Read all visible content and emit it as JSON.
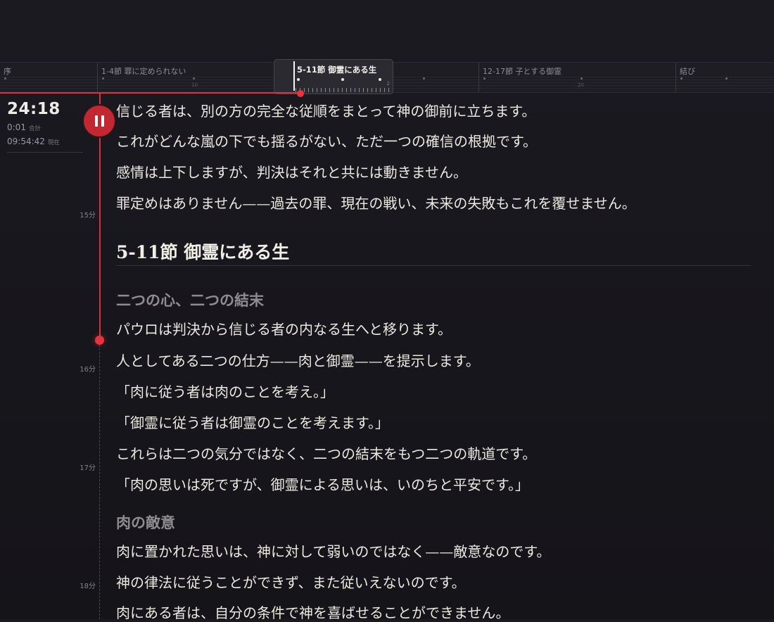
{
  "timeline": {
    "segments": [
      {
        "label": "序"
      },
      {
        "label": "1-4節 罪に定められない"
      },
      {
        "label": "5-11節 御霊にある生"
      },
      {
        "label": "12-17節 子とする御霊"
      },
      {
        "label": "結び"
      }
    ],
    "active_label": "5-11節 御霊にある生",
    "tick_labels": [
      "10",
      "20",
      "2"
    ]
  },
  "clock": {
    "elapsed": "24:18",
    "total_value": "0:01",
    "total_label": "合計",
    "now_value": "09:54:42",
    "now_label": "現在"
  },
  "minute_marks": [
    "15分",
    "16分",
    "17分",
    "18分"
  ],
  "text": {
    "lines_before": [
      "信じる者は、別の方の完全な従順をまとって神の御前に立ちます。",
      "これがどんな嵐の下でも揺るがない、ただ一つの確信の根拠です。",
      "感情は上下しますが、判決はそれと共には動きません。",
      "罪定めはありません——過去の罪、現在の戦い、未来の失敗もこれを覆せません。"
    ],
    "section_title": "5-11節 御霊にある生",
    "subhead1": "二つの心、二つの結末",
    "lines_section1": [
      "パウロは判決から信じる者の内なる生へと移ります。",
      "人としてある二つの仕方——肉と御霊——を提示します。",
      "「肉に従う者は肉のことを考え。」",
      "「御霊に従う者は御霊のことを考えます。」",
      "これらは二つの気分ではなく、二つの結末をもつ二つの軌道です。",
      "「肉の思いは死ですが、御霊による思いは、いのちと平安です。」"
    ],
    "subhead2": "肉の敵意",
    "lines_section2": [
      "肉に置かれた思いは、神に対して弱いのではなく——敵意なのです。",
      "神の律法に従うことができず、また従いえないのです。",
      "肉にある者は、自分の条件で神を喜ばせることができません。"
    ]
  },
  "colors": {
    "accent": "#e0323c",
    "background": "#18171d",
    "text": "#ece9e1",
    "subhead": "#8e8c90"
  },
  "icons": {
    "pause": "pause-icon"
  }
}
